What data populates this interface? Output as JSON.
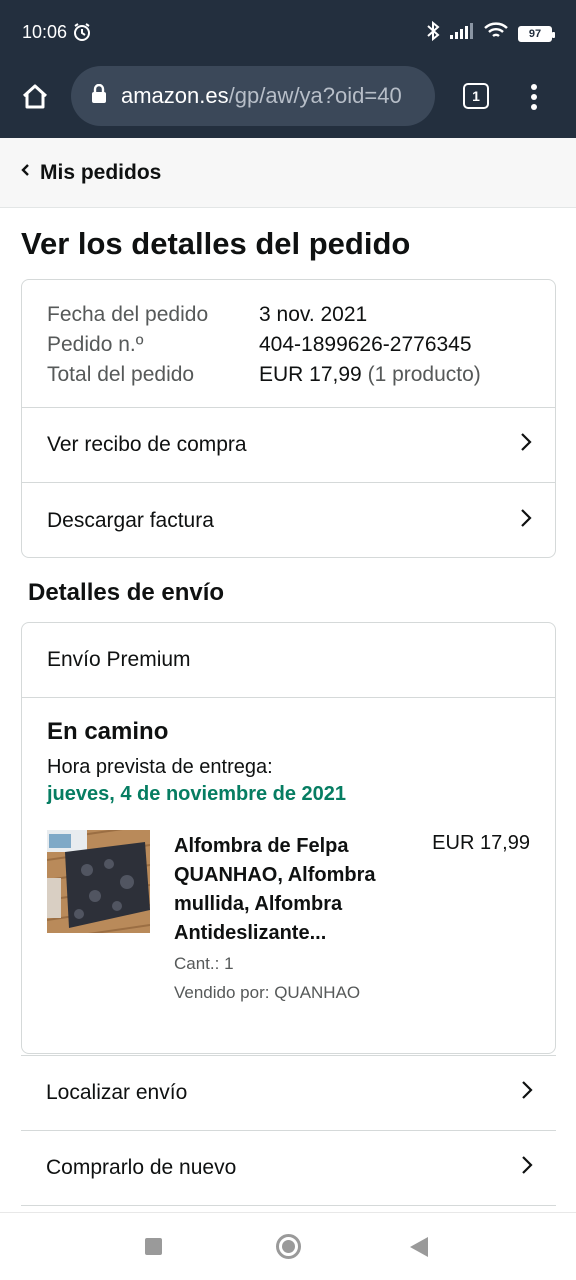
{
  "status_bar": {
    "time": "10:06",
    "battery": "97"
  },
  "browser": {
    "url_host": "amazon.es",
    "url_path": "/gp/aw/ya?oid=40",
    "tab_count": "1"
  },
  "breadcrumb": {
    "label": "Mis pedidos"
  },
  "page_title": "Ver los detalles del pedido",
  "order_summary": {
    "date_label": "Fecha del pedido",
    "date_value": "3 nov. 2021",
    "number_label": "Pedido n.º",
    "number_value": "404-1899626-2776345",
    "total_label": "Total del pedido",
    "total_value": "EUR 17,99",
    "total_count": "(1 producto)"
  },
  "order_links": {
    "receipt": "Ver recibo de compra",
    "invoice": "Descargar factura"
  },
  "shipping": {
    "section_title": "Detalles de envío",
    "type": "Envío Premium",
    "status": "En camino",
    "eta_label": "Hora prevista de entrega:",
    "eta_date": "jueves, 4 de noviembre de 2021",
    "item": {
      "title": "Alfombra de Felpa QUANHAO, Alfombra mullida, Alfombra Antideslizante...",
      "price": "EUR 17,99",
      "quantity": "Cant.: 1",
      "seller": "Vendido por: QUANHAO"
    }
  },
  "actions": {
    "track": "Localizar envío",
    "buy_again": "Comprarlo de nuevo"
  },
  "colors": {
    "header_bg": "#232f3e",
    "delivery_green": "#067d62"
  }
}
